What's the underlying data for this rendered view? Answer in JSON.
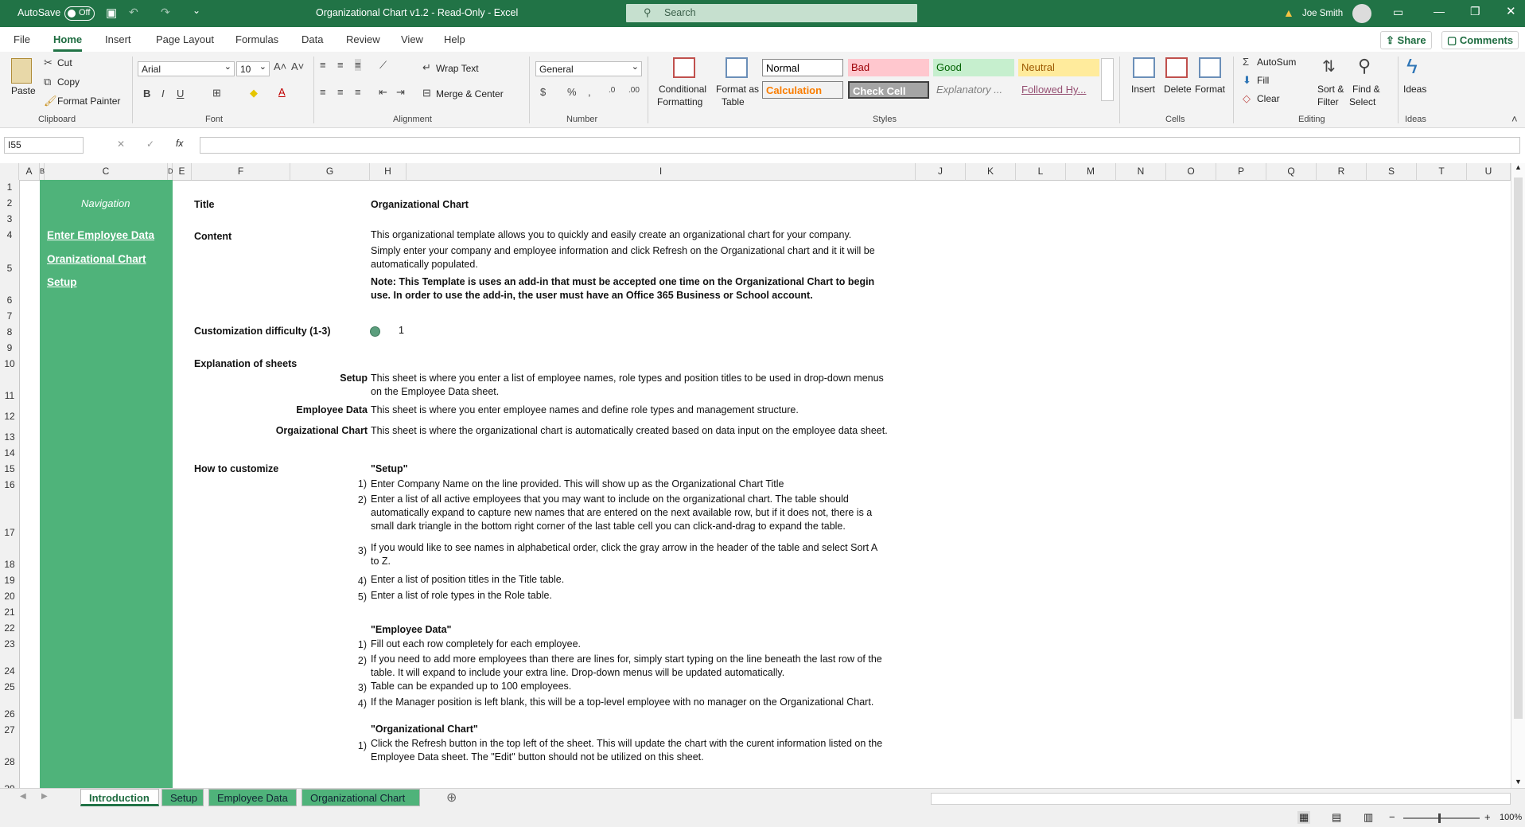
{
  "titlebar": {
    "autosave_label": "AutoSave",
    "autosave_state": "Off",
    "doc_title": "Organizational Chart v1.2  -  Read-Only  -  Excel",
    "search_placeholder": "Search",
    "user_name": "Joe Smith"
  },
  "menu": {
    "items": [
      "File",
      "Home",
      "Insert",
      "Page Layout",
      "Formulas",
      "Data",
      "Review",
      "View",
      "Help"
    ],
    "active": "Home",
    "share": "Share",
    "comments": "Comments"
  },
  "ribbon": {
    "clipboard": {
      "paste": "Paste",
      "cut": "Cut",
      "copy": "Copy",
      "format_painter": "Format Painter",
      "label": "Clipboard"
    },
    "font": {
      "name": "Arial",
      "size": "10",
      "label": "Font"
    },
    "alignment": {
      "wrap": "Wrap Text",
      "merge": "Merge & Center",
      "label": "Alignment"
    },
    "number": {
      "format": "General",
      "label": "Number"
    },
    "styles": {
      "conditional": "Conditional",
      "formatting": "Formatting",
      "format_as": "Format as",
      "table": "Table",
      "normal": "Normal",
      "bad": "Bad",
      "good": "Good",
      "neutral": "Neutral",
      "calculation": "Calculation",
      "check_cell": "Check Cell",
      "explanatory": "Explanatory ...",
      "followed": "Followed Hy...",
      "label": "Styles"
    },
    "cells": {
      "insert": "Insert",
      "delete": "Delete",
      "format": "Format",
      "label": "Cells"
    },
    "editing": {
      "autosum": "AutoSum",
      "fill": "Fill",
      "clear": "Clear",
      "sort": "Sort &",
      "filter": "Filter",
      "find": "Find &",
      "select": "Select",
      "label": "Editing"
    },
    "ideas": {
      "ideas": "Ideas",
      "label": "Ideas"
    }
  },
  "formula_bar": {
    "name_box": "I55",
    "formula": ""
  },
  "columns": [
    "A",
    "B",
    "C",
    "D",
    "E",
    "F",
    "G",
    "H",
    "I",
    "J",
    "K",
    "L",
    "M",
    "N",
    "O",
    "P",
    "Q",
    "R",
    "S",
    "T",
    "U"
  ],
  "rows": [
    "1",
    "2",
    "3",
    "4",
    "5",
    "6",
    "7",
    "8",
    "9",
    "10",
    "11",
    "12",
    "13",
    "14",
    "15",
    "16",
    "17",
    "18",
    "19",
    "20",
    "21",
    "22",
    "23",
    "24",
    "25",
    "26",
    "27",
    "28",
    "29"
  ],
  "nav": {
    "heading": "Navigation",
    "links": [
      "Enter Employee Data",
      "Oranizational Chart",
      "Setup"
    ]
  },
  "content": {
    "title_label": "Title",
    "title_value": "Organizational Chart",
    "content_label": "Content",
    "content_lines": [
      "This organizational template allows you to quickly and easily create an organizational chart for your company.",
      "Simply enter your company and employee information and click Refresh on the Organizational chart and it it will be",
      "automatically populated."
    ],
    "note_lines": [
      "Note: This Template is uses an add-in that must be accepted one time on the Organizational Chart to begin",
      "use. In order to use the add-in, the user must have an Office 365 Business or School account."
    ],
    "difficulty_label": "Customization difficulty (1-3)",
    "difficulty_value": "1",
    "explanation_label": "Explanation of sheets",
    "sheets": [
      {
        "name": "Setup",
        "lines": [
          "This sheet is where you enter a list of employee names, role types and position titles to be used in drop-down menus",
          "on the Employee Data sheet."
        ]
      },
      {
        "name": "Employee Data",
        "lines": [
          "This sheet is where you enter employee names and define role types and management structure."
        ]
      },
      {
        "name": "Orgaizational Chart",
        "lines": [
          "This sheet is where the organizational chart is automatically created based on data input on the employee data sheet."
        ]
      }
    ],
    "customize_label": "How to customize",
    "setup_heading": "\"Setup\"",
    "setup_steps": [
      {
        "n": "1)",
        "lines": [
          "Enter Company Name on the line provided. This will show up as the Organizational Chart Title"
        ]
      },
      {
        "n": "2)",
        "lines": [
          "Enter a list of all active employees that you may want to include on the organizational chart. The table should",
          "automatically expand to capture new names that are entered on the next available row, but if it does not, there is a",
          "small dark triangle in the bottom right corner of the last table cell you can  click-and-drag to expand the table."
        ]
      },
      {
        "n": "3)",
        "lines": [
          "If you would like to see names in alphabetical order, click the gray arrow in the header of the table and select Sort A",
          "to Z."
        ]
      },
      {
        "n": "4)",
        "lines": [
          "Enter a list of position titles in the Title table."
        ]
      },
      {
        "n": "5)",
        "lines": [
          "Enter a list of role types in the Role table."
        ]
      }
    ],
    "employee_heading": "\"Employee Data\"",
    "employee_steps": [
      {
        "n": "1)",
        "lines": [
          "Fill out each row completely for each employee."
        ]
      },
      {
        "n": "2)",
        "lines": [
          "If you need to add more employees than there are lines for, simply start typing on the line beneath the last row of the",
          "table. It will expand to include your extra line. Drop-down menus will be updated automatically."
        ]
      },
      {
        "n": "3)",
        "lines": [
          "Table can be expanded up to 100 employees."
        ]
      },
      {
        "n": "4)",
        "lines": [
          "If the Manager position is left blank, this will be a top-level employee with no manager on the Organizational Chart."
        ]
      }
    ],
    "org_heading": "\"Organizational Chart\"",
    "org_steps": [
      {
        "n": "1)",
        "lines": [
          "Click the Refresh button in the top left of the sheet.  This will update the chart with the curent information listed on the",
          "Employee Data sheet. The \"Edit\" button should not be utilized on this sheet."
        ]
      }
    ]
  },
  "tabs": [
    "Introduction",
    "Setup",
    "Employee Data",
    "Organizational Chart"
  ],
  "active_tab": "Introduction",
  "status": {
    "zoom": "100%"
  },
  "colors": {
    "excel_green": "#217346",
    "nav_green": "#4fb37a",
    "tab_green": "#4fb37a",
    "bullet": "#5b9e7d"
  }
}
